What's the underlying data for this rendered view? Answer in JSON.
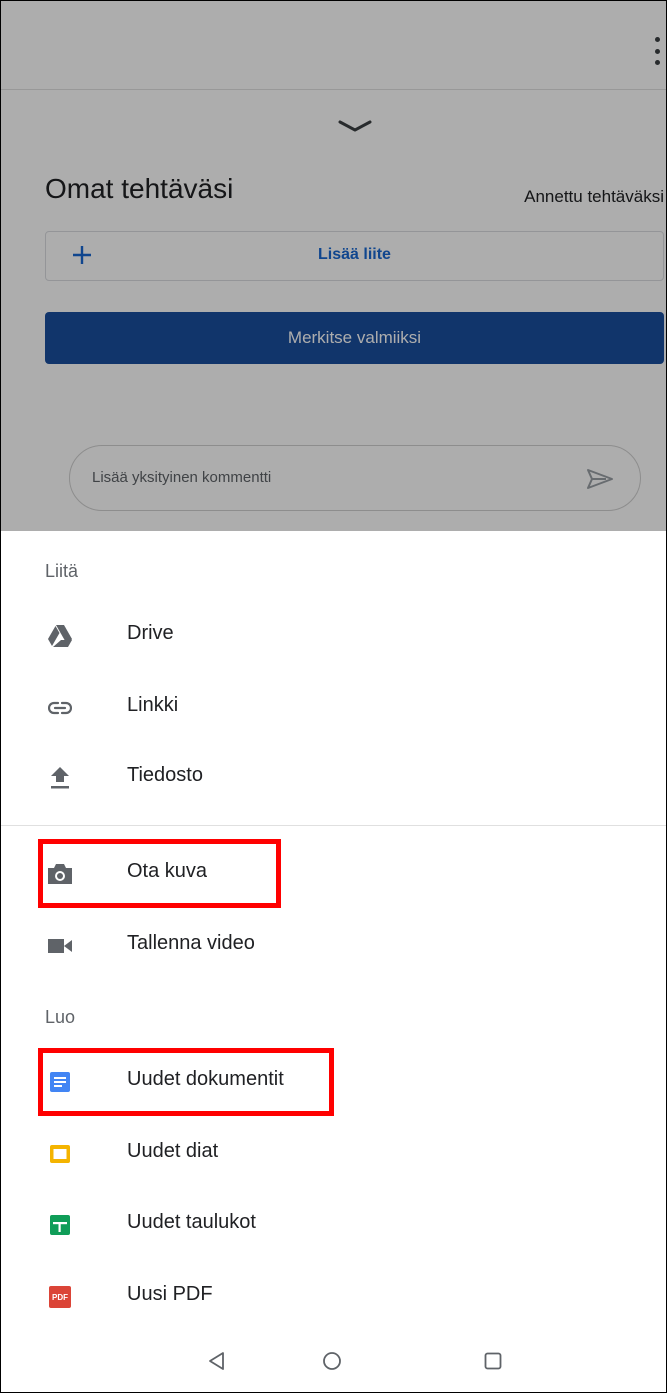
{
  "background": {
    "heading": "Omat tehtäväsi",
    "status": "Annettu tehtäväksi",
    "attach_label": "Lisää liite",
    "mark_done_label": "Merkitse valmiiksi",
    "comment_placeholder": "Lisää yksityinen kommentti"
  },
  "sheet": {
    "sections": [
      {
        "title": "Liitä",
        "items": [
          {
            "label": "Drive",
            "icon": "drive-icon"
          },
          {
            "label": "Linkki",
            "icon": "link-icon"
          },
          {
            "label": "Tiedosto",
            "icon": "upload-icon"
          },
          {
            "label": "Ota kuva",
            "icon": "camera-icon"
          },
          {
            "label": "Tallenna video",
            "icon": "video-icon"
          }
        ]
      },
      {
        "title": "Luo",
        "items": [
          {
            "label": "Uudet dokumentit",
            "icon": "docs-icon",
            "color": "#4285f4"
          },
          {
            "label": "Uudet diat",
            "icon": "slides-icon",
            "color": "#f4b400"
          },
          {
            "label": "Uudet taulukot",
            "icon": "sheets-icon",
            "color": "#0f9d58"
          },
          {
            "label": "Uusi PDF",
            "icon": "pdf-icon",
            "color": "#db4437",
            "icon_text": "PDF"
          }
        ]
      }
    ]
  },
  "highlight_color": "#ff0000",
  "navbar": {
    "buttons": [
      "back-icon",
      "home-icon",
      "recents-icon"
    ]
  }
}
